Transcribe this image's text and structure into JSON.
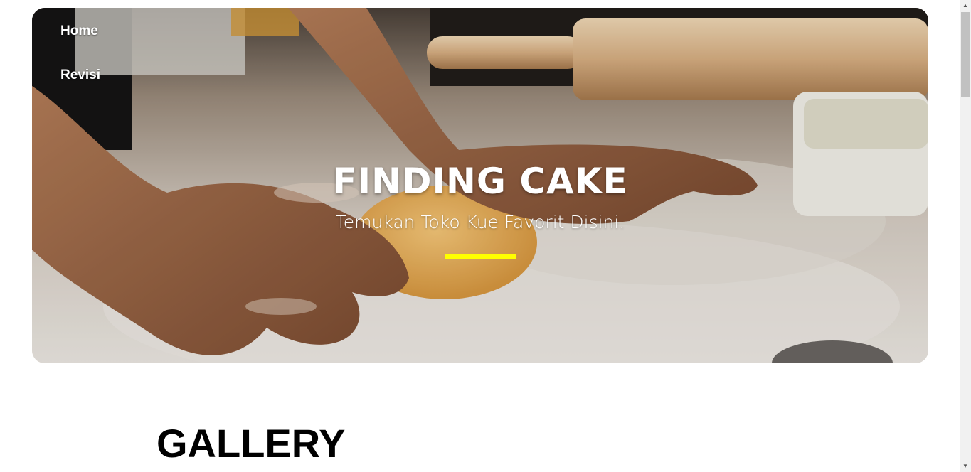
{
  "nav": {
    "items": [
      {
        "label": "Home"
      },
      {
        "label": "Revisi"
      }
    ]
  },
  "hero": {
    "title": "FINDING CAKE",
    "subtitle": "Temukan Toko Kue Favorit Disini.",
    "accent_color": "#ffff00",
    "background_description_icon": "baking-photo"
  },
  "gallery": {
    "title": "GALLERY"
  },
  "scrollbar": {
    "up_icon": "triangle-up",
    "down_icon": "triangle-down"
  }
}
